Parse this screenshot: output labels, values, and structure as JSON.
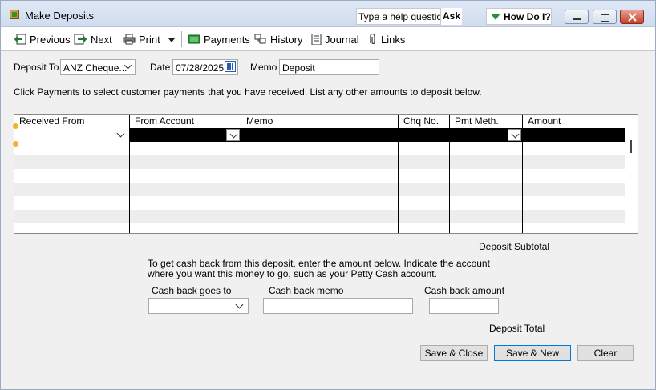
{
  "window": {
    "title": "Make Deposits",
    "help_placeholder": "Type a help question",
    "ask_label": "Ask",
    "how_do_i_label": "How Do I?"
  },
  "toolbar": {
    "previous": "Previous",
    "next": "Next",
    "print": "Print",
    "payments": "Payments",
    "history": "History",
    "journal": "Journal",
    "links": "Links"
  },
  "form": {
    "deposit_to_label": "Deposit To",
    "deposit_to_value": "ANZ Cheque...",
    "date_label": "Date",
    "date_value": "07/28/2025",
    "memo_label": "Memo",
    "memo_value": "Deposit"
  },
  "instructions": "Click Payments to select customer payments that you have received. List any other amounts to deposit below.",
  "table": {
    "columns": [
      "Received From",
      "From Account",
      "Memo",
      "Chq No.",
      "Pmt Meth.",
      "Amount"
    ]
  },
  "subtotal_label": "Deposit Subtotal",
  "cash_back": {
    "line1": "To get cash back from this deposit, enter the amount below.  Indicate the account",
    "line2": "where you want this money to go, such as your Petty Cash account.",
    "goes_to_label": "Cash back goes to",
    "memo_label": "Cash back memo",
    "amount_label": "Cash back amount"
  },
  "total_label": "Deposit Total",
  "buttons": {
    "save_close": "Save & Close",
    "save_new": "Save & New",
    "clear": "Clear"
  },
  "colors": {
    "titlebar": "#cfdcee",
    "accent": "#0078d7",
    "dot": "#f1b22c"
  }
}
